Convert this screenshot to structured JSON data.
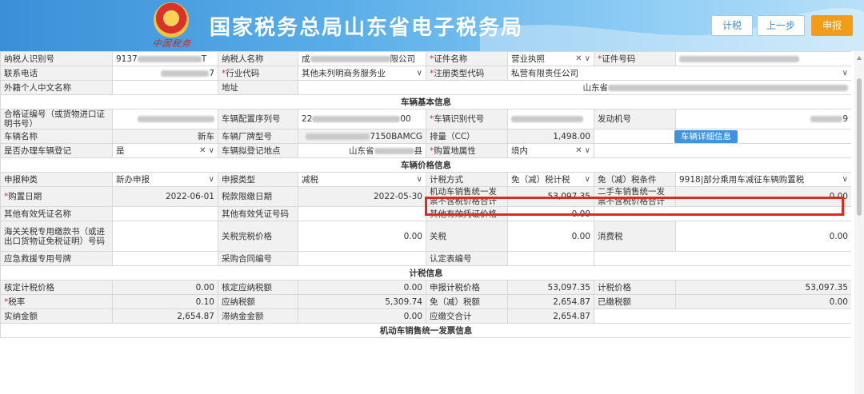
{
  "header": {
    "title": "国家税务总局山东省电子税务局",
    "emblem_text": "中国税务",
    "buttons": {
      "calc": "计税",
      "prev": "上一步",
      "submit": "申报"
    },
    "colors": {
      "header_start": "#3a8fd8",
      "submit": "#f39c1a",
      "highlight": "#e02a20"
    }
  },
  "r1": {
    "a_lbl": "纳税人识别号",
    "a_val": "9137",
    "a_tail": "T",
    "b_lbl": "纳税人名称",
    "b_val": "成",
    "b_tail": "限公司",
    "c_lbl": "证件名称",
    "c_val": "营业执照",
    "d_lbl": "证件号码"
  },
  "r2": {
    "a_lbl": "联系电话",
    "a_tail": "7",
    "b_lbl": "行业代码",
    "b_val": "其他未列明商务服务业",
    "c_lbl": "注册类型代码",
    "c_val": "私营有限责任公司"
  },
  "r3": {
    "a_lbl": "外籍个人中文名称",
    "b_lbl": "地址",
    "b_val": "山东省"
  },
  "sec_vehicle": "车辆基本信息",
  "r4": {
    "a_lbl": "合格证编号（或货物进口证明书号）",
    "b_lbl": "车辆配置序列号",
    "b_val": "22",
    "b_tail": "00",
    "c_lbl": "车辆识别代号",
    "d_lbl": "发动机号",
    "d_tail": "9"
  },
  "r5": {
    "a_lbl": "车辆名称",
    "a_val": "新车",
    "b_lbl": "车辆厂牌型号",
    "b_val": "7150BAMCG",
    "c_lbl": "排量（CC）",
    "c_val": "1,498.00",
    "detail_btn": "车辆详细信息"
  },
  "r6": {
    "a_lbl": "是否办理车辆登记",
    "a_val": "是",
    "b_lbl": "车辆拟登记地点",
    "b_val": "山东省",
    "b_tail": "县",
    "c_lbl": "购置地属性",
    "c_val": "境内"
  },
  "sec_price": "车辆价格信息",
  "r7": {
    "a_lbl": "申报种类",
    "a_val": "新办申报",
    "b_lbl": "申报类型",
    "b_val": "减税",
    "c_lbl": "计税方式",
    "c_val": "免（减）税计税",
    "d_lbl": "免（减）税条件",
    "d_val": "9918|部分乘用车减征车辆购置税"
  },
  "r8": {
    "a_lbl": "购置日期",
    "a_val": "2022-06-01",
    "b_lbl": "税款限缴日期",
    "b_val": "2022-05-30",
    "c_lbl": "机动车销售统一发票不含税价格合计",
    "c_val": "53,097.35",
    "d_lbl": "二手车销售统一发票不含税价格合计",
    "d_val": "0.00"
  },
  "r9": {
    "a_lbl": "其他有效凭证名称",
    "b_lbl": "其他有效凭证号码",
    "c_lbl": "其他有效凭证价格",
    "c_val": "0.00"
  },
  "r10": {
    "a_lbl": "海关关税专用缴款书（或进出口货物证免税证明）号码",
    "b_lbl": "关税完税价格",
    "b_val": "0.00",
    "c_lbl": "关税",
    "c_val": "0.00",
    "d_lbl": "消费税",
    "d_val": "0.00"
  },
  "r11": {
    "a_lbl": "应急救援专用号牌",
    "b_lbl": "采购合同编号",
    "c_lbl": "认定表编号"
  },
  "sec_tax": "计税信息",
  "r12": {
    "a_lbl": "核定计税价格",
    "a_val": "0.00",
    "b_lbl": "核定应纳税额",
    "b_val": "0.00",
    "c_lbl": "申报计税价格",
    "c_val": "53,097.35",
    "d_lbl": "计税价格",
    "d_val": "53,097.35"
  },
  "r13": {
    "a_lbl": "税率",
    "a_val": "0.10",
    "b_lbl": "应纳税额",
    "b_val": "5,309.74",
    "c_lbl": "免（减）税额",
    "c_val": "2,654.87",
    "d_lbl": "已缴税额",
    "d_val": "0.00"
  },
  "r14": {
    "a_lbl": "实纳金额",
    "a_val": "2,654.87",
    "b_lbl": "滞纳金金额",
    "b_val": "0.00",
    "c_lbl": "应缴交合计",
    "c_val": "2,654.87"
  },
  "sec_invoice": "机动车销售统一发票信息"
}
